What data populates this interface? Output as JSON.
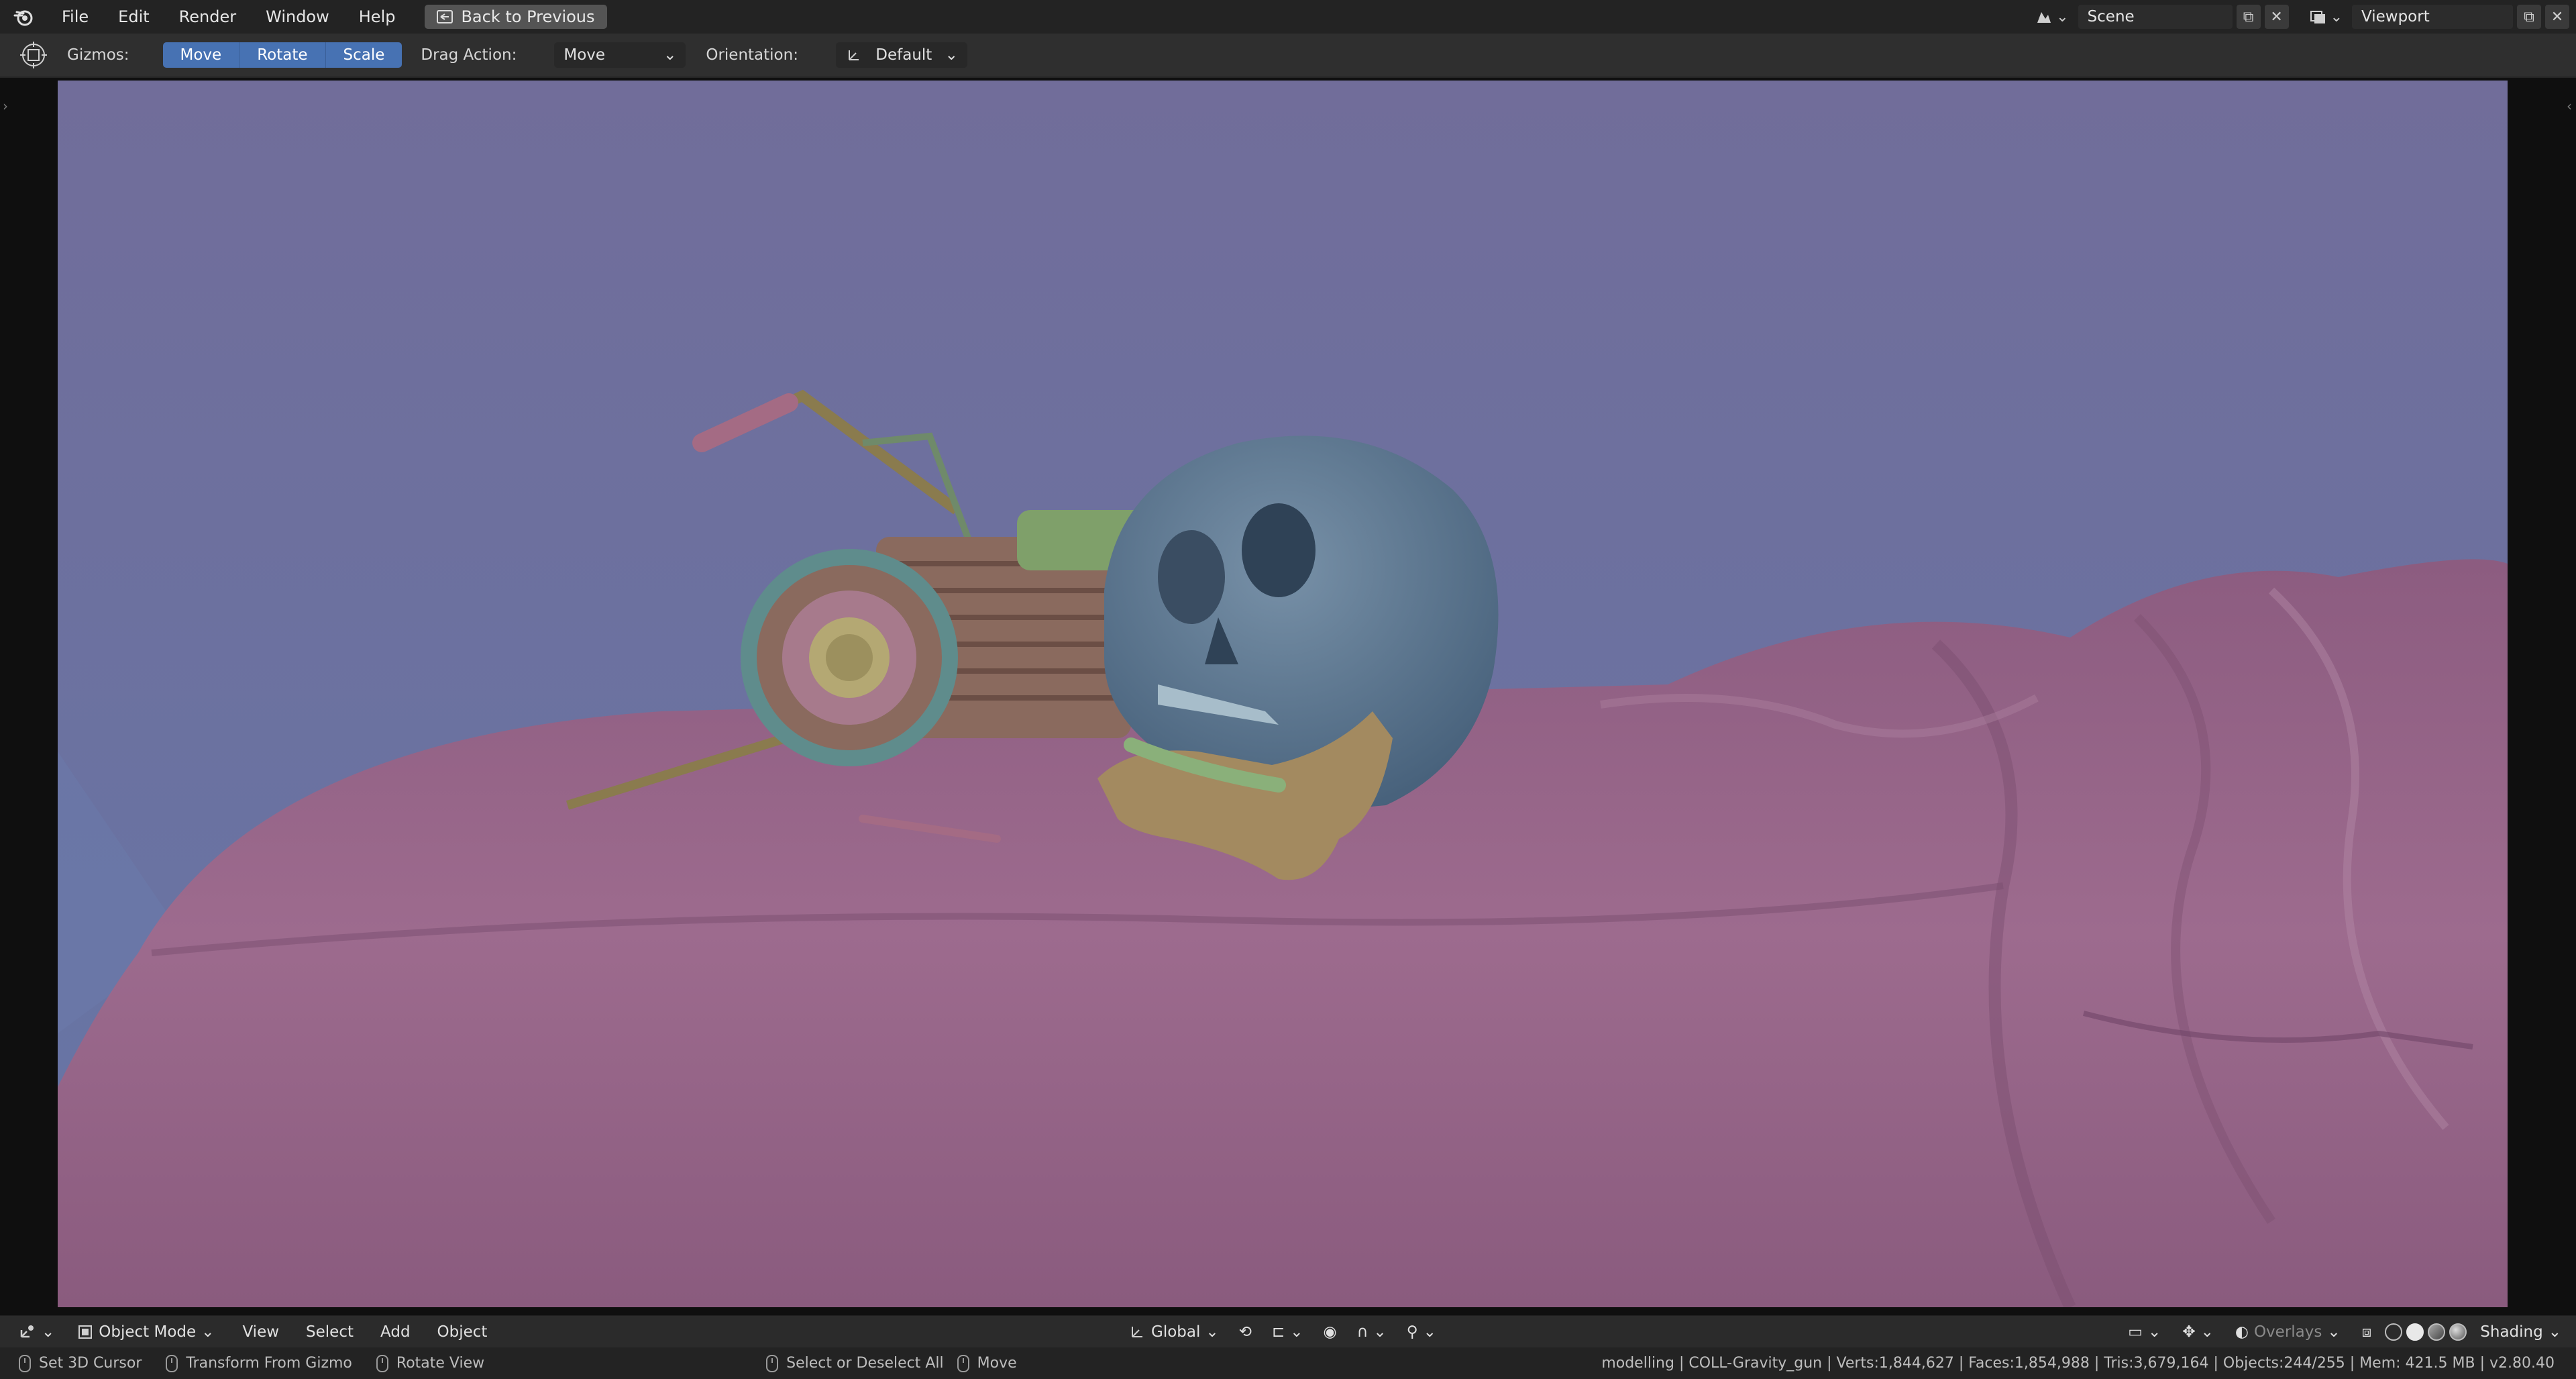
{
  "app": {
    "menus": [
      "File",
      "Edit",
      "Render",
      "Window",
      "Help"
    ],
    "back_button": "Back to Previous",
    "scene_name": "Scene",
    "view_layer_name": "Viewport"
  },
  "tool_settings": {
    "gizmos_label": "Gizmos:",
    "gizmo_buttons": [
      "Move",
      "Rotate",
      "Scale"
    ],
    "drag_action_label": "Drag Action:",
    "drag_action_value": "Move",
    "orientation_label": "Orientation:",
    "orientation_value": "Default"
  },
  "viewport_header": {
    "mode": "Object Mode",
    "menus": [
      "View",
      "Select",
      "Add",
      "Object"
    ],
    "transform_orientation": "Global",
    "overlays_label": "Overlays",
    "shading_label": "Shading"
  },
  "status_bar": {
    "hints": [
      {
        "icon": "mouse-left-icon",
        "label": "Set 3D Cursor"
      },
      {
        "icon": "mouse-drag-icon",
        "label": "Transform From Gizmo"
      },
      {
        "icon": "mouse-middle-icon",
        "label": "Rotate View"
      },
      {
        "icon": "mouse-left-icon",
        "label": "Select or Deselect All"
      },
      {
        "icon": "mouse-drag-icon",
        "label": "Move"
      }
    ],
    "scene_stats": "modelling | COLL-Gravity_gun | Verts:1,844,627 | Faces:1,854,988 | Tris:3,679,164 | Objects:244/255 | Mem: 421.5 MB | v2.80.40"
  },
  "colors": {
    "accent": "#4772b3",
    "viewport_bg_top": "#6e6a96",
    "cloth": "#9a6a8c",
    "skull": "#5f7a93",
    "jaw": "#a38a60",
    "teeth": "#8ab07a"
  }
}
